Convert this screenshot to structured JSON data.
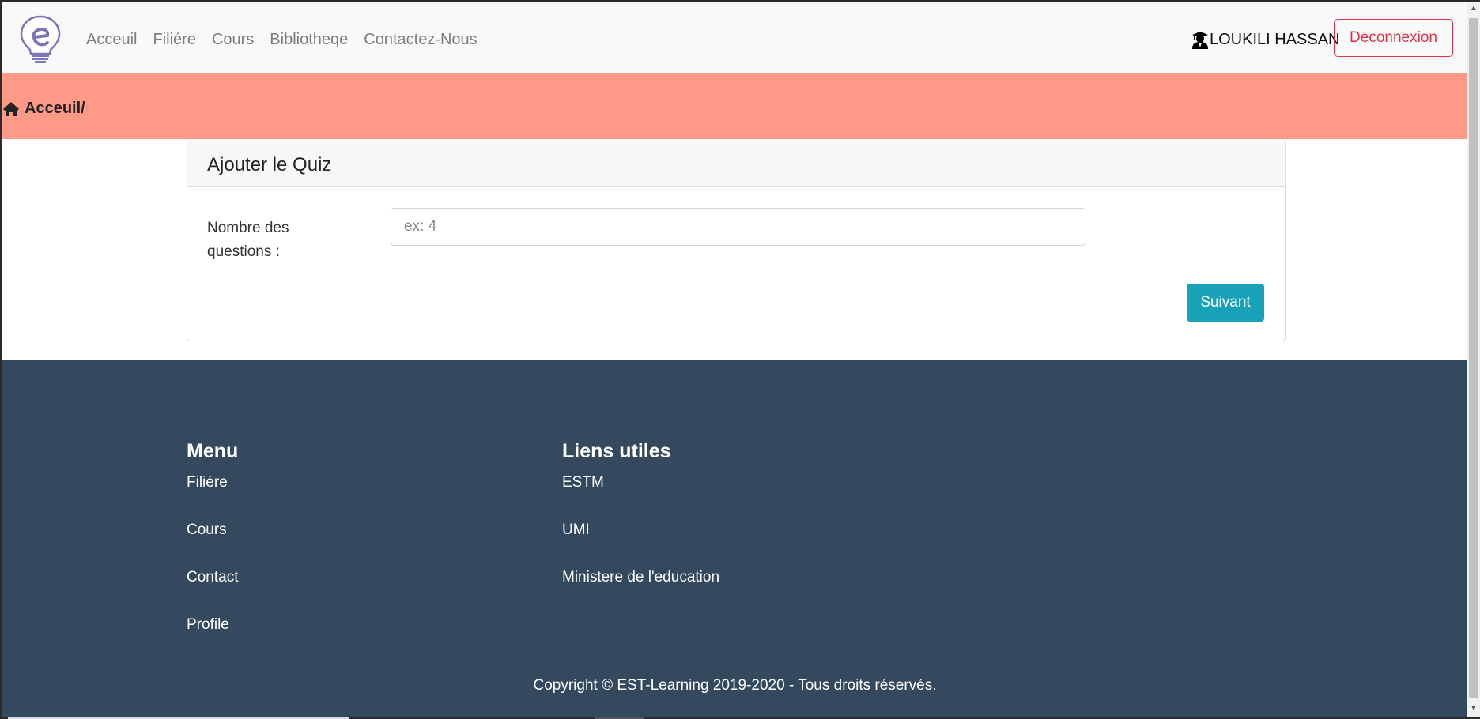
{
  "navbar": {
    "links": [
      "Acceuil",
      "Filiére",
      "Cours",
      "Bibliotheqe",
      "Contactez-Nous"
    ],
    "user_name": "LOUKILI HASSAN",
    "logout_label": "Deconnexion"
  },
  "breadcrumb": {
    "label": "Acceuil/"
  },
  "quiz_card": {
    "title": "Ajouter le Quiz",
    "field_label": "Nombre des questions :",
    "field_placeholder": "ex: 4",
    "field_value": "",
    "next_label": "Suivant"
  },
  "footer": {
    "menu": {
      "title": "Menu",
      "items": [
        "Filiére",
        "Cours",
        "Contact",
        "Profile"
      ]
    },
    "links": {
      "title": "Liens utiles",
      "items": [
        "ESTM",
        "UMI",
        "Ministere de l'education"
      ]
    },
    "copyright": "Copyright © EST-Learning 2019-2020 - Tous droits réservés."
  },
  "colors": {
    "navbar_bg": "#f8f9fa",
    "breadcrumb_bg": "#ff9a88",
    "footer_bg": "#34495e",
    "danger": "#dc3545",
    "info": "#17a2b8"
  },
  "icons": [
    "lightbulb-logo-icon",
    "user-graduate-icon",
    "home-icon"
  ]
}
